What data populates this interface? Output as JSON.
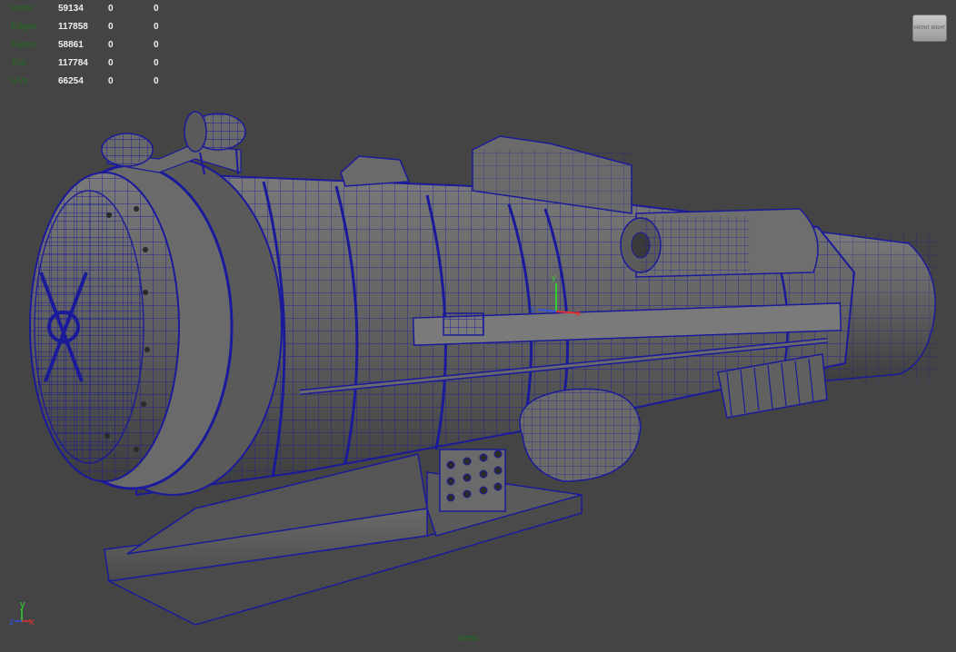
{
  "hud": {
    "stats": [
      {
        "label": "Verts:",
        "v1": "59134",
        "v2": "0",
        "v3": "0"
      },
      {
        "label": "Edges:",
        "v1": "117858",
        "v2": "0",
        "v3": "0"
      },
      {
        "label": "Faces:",
        "v1": "58861",
        "v2": "0",
        "v3": "0"
      },
      {
        "label": "Tris:",
        "v1": "117784",
        "v2": "0",
        "v3": "0"
      },
      {
        "label": "UVs:",
        "v1": "66254",
        "v2": "0",
        "v3": "0"
      }
    ],
    "camera": "persp"
  },
  "viewcube": {
    "front": "FRONT",
    "right": "RIGHT"
  },
  "axes": {
    "x": "x",
    "y": "y",
    "z": "z"
  },
  "colors": {
    "background": "#444444",
    "wireframe": "#1a1a9a",
    "stat_label": "#1f6e1f",
    "axis_x": "#e03030",
    "axis_y": "#30d030",
    "axis_z": "#3050e0"
  }
}
